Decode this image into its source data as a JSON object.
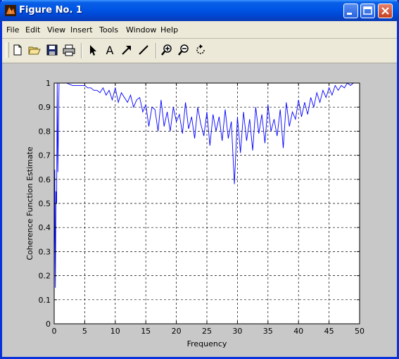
{
  "window": {
    "title": "Figure No. 1",
    "title_bar_color": "#0054e3",
    "figure_background": "#c8c8c8"
  },
  "menu": {
    "items": [
      "File",
      "Edit",
      "View",
      "Insert",
      "Tools",
      "Window",
      "Help"
    ]
  },
  "toolbar": {
    "icons": [
      "new-figure-icon",
      "open-file-icon",
      "save-icon",
      "print-icon",
      "edit-plot-arrow-icon",
      "insert-text-icon",
      "insert-arrow-icon",
      "insert-line-icon",
      "zoom-in-icon",
      "zoom-out-icon",
      "rotate-3d-icon"
    ]
  },
  "chart_data": {
    "type": "line",
    "title": "",
    "xlabel": "Frequency",
    "ylabel": "Coherence Function Estimate",
    "xlim": [
      0,
      50
    ],
    "ylim": [
      0,
      1
    ],
    "xticks": [
      "0",
      "5",
      "10",
      "15",
      "20",
      "25",
      "30",
      "35",
      "40",
      "45",
      "50"
    ],
    "yticks": [
      "0",
      "0.1",
      "0.2",
      "0.3",
      "0.4",
      "0.5",
      "0.6",
      "0.7",
      "0.8",
      "0.9",
      "1"
    ],
    "grid": true,
    "line_color": "#0000ff",
    "series": [
      {
        "x": [
          0,
          0.1,
          0.2,
          0.3,
          0.4,
          0.5,
          0.6,
          0.8,
          1,
          1.5,
          2,
          3,
          4,
          5,
          5.5,
          6,
          6.5,
          7,
          7.5,
          8,
          8.5,
          9,
          9.5,
          10,
          10.5,
          11,
          11.5,
          12,
          12.5,
          13,
          13.5,
          14,
          14.5,
          15,
          15.5,
          16,
          16.5,
          17,
          17.5,
          18,
          18.5,
          19,
          19.5,
          20,
          20.5,
          21,
          21.5,
          22,
          22.5,
          23,
          23.5,
          24,
          24.5,
          25,
          25.5,
          26,
          26.5,
          27,
          27.5,
          28,
          28.5,
          29,
          29.5,
          30,
          30.5,
          31,
          31.5,
          32,
          32.5,
          33,
          33.5,
          34,
          34.5,
          35,
          35.5,
          36,
          36.5,
          37,
          37.5,
          38,
          38.5,
          39,
          39.5,
          40,
          40.5,
          41,
          41.5,
          42,
          42.5,
          43,
          43.5,
          44,
          44.5,
          45,
          45.5,
          46,
          46.5,
          47,
          47.5,
          48,
          48.5,
          49,
          50
        ],
        "y": [
          0.08,
          0.64,
          0.15,
          0.55,
          0.5,
          1.0,
          0.63,
          1.0,
          1.0,
          1.0,
          1.0,
          0.99,
          0.99,
          0.99,
          0.98,
          0.98,
          0.97,
          0.97,
          0.96,
          0.98,
          0.95,
          0.97,
          0.93,
          0.98,
          0.92,
          0.96,
          0.94,
          0.92,
          0.95,
          0.9,
          0.93,
          0.94,
          0.88,
          0.91,
          0.82,
          0.9,
          0.89,
          0.8,
          0.93,
          0.82,
          0.88,
          0.8,
          0.9,
          0.84,
          0.87,
          0.79,
          0.92,
          0.81,
          0.86,
          0.77,
          0.9,
          0.83,
          0.78,
          0.88,
          0.74,
          0.87,
          0.8,
          0.86,
          0.76,
          0.89,
          0.77,
          0.84,
          0.58,
          0.86,
          0.71,
          0.88,
          0.76,
          0.85,
          0.72,
          0.9,
          0.79,
          0.87,
          0.75,
          0.91,
          0.8,
          0.85,
          0.78,
          0.89,
          0.73,
          0.92,
          0.82,
          0.88,
          0.85,
          0.93,
          0.86,
          0.92,
          0.87,
          0.94,
          0.9,
          0.96,
          0.92,
          0.97,
          0.94,
          0.98,
          0.95,
          0.99,
          0.97,
          0.99,
          0.98,
          1.0,
          0.99,
          1.0,
          1.0
        ]
      }
    ]
  }
}
